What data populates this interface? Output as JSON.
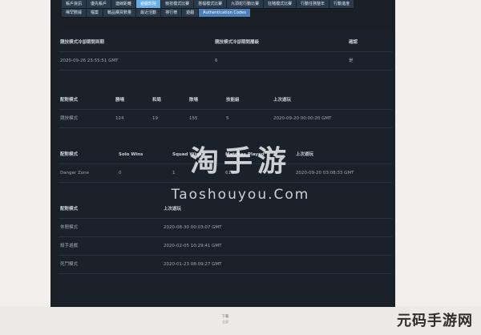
{
  "tabs_row1": [
    "帳戶資訊",
    "優先帳戶",
    "連線距離",
    "遊戲影院",
    "競技模式比賽",
    "搭檔模式比賽",
    "九頭蛇行動比賽",
    "狂賭模式比賽",
    "行動任務整年",
    "行動進度"
  ],
  "tabs_row2": [
    "稀罕數據",
    "檔案",
    "戰品購買數量",
    "最近活動",
    "排行榜",
    "遊戲",
    "Authentication Codes"
  ],
  "table1": {
    "headers": [
      "競技模式冷卻期間到期",
      "競技模式冷卻期間層級",
      "確認"
    ],
    "row": [
      "2020-09-26 23:55:51 GMT",
      "6",
      "是"
    ]
  },
  "table2": {
    "headers": [
      "配對模式",
      "勝場",
      "和局",
      "敗場",
      "技能組",
      "上次遊玩"
    ],
    "row": [
      "競技模式",
      "124",
      "19",
      "155",
      "5",
      "2020-09-20 00:00:20 GMT"
    ]
  },
  "table3": {
    "headers": [
      "配對模式",
      "Solo Wins",
      "Squad Wins",
      "Matches Played",
      "上次遊玩"
    ],
    "row": [
      "Danger Zone",
      "0",
      "1",
      "61",
      "2020-09-20 03:08:33 GMT"
    ]
  },
  "table4": {
    "headers": [
      "配對模式",
      "上次遊玩"
    ],
    "rows": [
      [
        "休閒模式",
        "2020-08-30 00:03:07 GMT"
      ],
      [
        "殺手遊戲",
        "2020-02-05 10:29:41 GMT"
      ],
      [
        "死鬥模式",
        "2020-01-23 08:09:27 GMT"
      ]
    ]
  },
  "watermark": {
    "cn": "淘手游",
    "en": "Taoshouyou.Com"
  },
  "footer": {
    "line1": "下載",
    "line2": "全部"
  },
  "brand": "元码手游网"
}
